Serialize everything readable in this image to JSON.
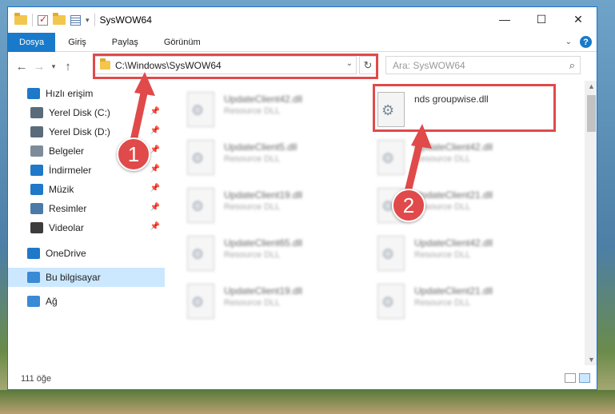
{
  "window": {
    "title": "SysWOW64"
  },
  "ribbon": {
    "tabs": [
      "Dosya",
      "Giriş",
      "Paylaş",
      "Görünüm"
    ]
  },
  "address": {
    "path": "C:\\Windows\\SysWOW64"
  },
  "search": {
    "placeholder": "Ara: SysWOW64"
  },
  "sidebar": {
    "items": [
      {
        "label": "Hızlı erişim",
        "icon": "star-icon",
        "color": "#1f78c8",
        "pinned": false,
        "top": true
      },
      {
        "label": "Yerel Disk (C:)",
        "icon": "drive-icon",
        "color": "#5a6b7a",
        "pinned": true
      },
      {
        "label": "Yerel Disk (D:)",
        "icon": "drive-icon",
        "color": "#5a6b7a",
        "pinned": true
      },
      {
        "label": "Belgeler",
        "icon": "documents-icon",
        "color": "#7e8c99",
        "pinned": true
      },
      {
        "label": "İndirmeler",
        "icon": "downloads-icon",
        "color": "#1f78c8",
        "pinned": true
      },
      {
        "label": "Müzik",
        "icon": "music-icon",
        "color": "#1f78c8",
        "pinned": true
      },
      {
        "label": "Resimler",
        "icon": "pictures-icon",
        "color": "#4a7ba8",
        "pinned": true
      },
      {
        "label": "Videolar",
        "icon": "videos-icon",
        "color": "#3c3c3c",
        "pinned": true
      },
      {
        "label": "OneDrive",
        "icon": "cloud-icon",
        "color": "#1f78c8",
        "top": true
      },
      {
        "label": "Bu bilgisayar",
        "icon": "computer-icon",
        "color": "#3a8ad6",
        "top": true,
        "selected": true
      },
      {
        "label": "Ağ",
        "icon": "network-icon",
        "color": "#3a8ad6",
        "top": true
      }
    ]
  },
  "files": [
    {
      "name": "UpdateClient42.dll",
      "type": "Resource DLL"
    },
    {
      "name": "nds groupwise.dll",
      "type": ""
    },
    {
      "name": "UpdateClient5.dll",
      "type": "Resource DLL"
    },
    {
      "name": "UpdateClient42.dll",
      "type": "Resource DLL"
    },
    {
      "name": "UpdateClient19.dll",
      "type": "Resource DLL"
    },
    {
      "name": "UpdateClient21.dll",
      "type": "Resource DLL"
    },
    {
      "name": "UpdateClient65.dll",
      "type": "Resource DLL"
    },
    {
      "name": "UpdateClient42.dll",
      "type": "Resource DLL"
    },
    {
      "name": "UpdateClient19.dll",
      "type": "Resource DLL"
    },
    {
      "name": "UpdateClient21.dll",
      "type": "Resource DLL"
    }
  ],
  "status": {
    "count": "111 öğe"
  },
  "callouts": [
    "1",
    "2"
  ],
  "colors": {
    "accent": "#1979ca",
    "highlight": "#e04a4a",
    "selected": "#cce8ff"
  }
}
